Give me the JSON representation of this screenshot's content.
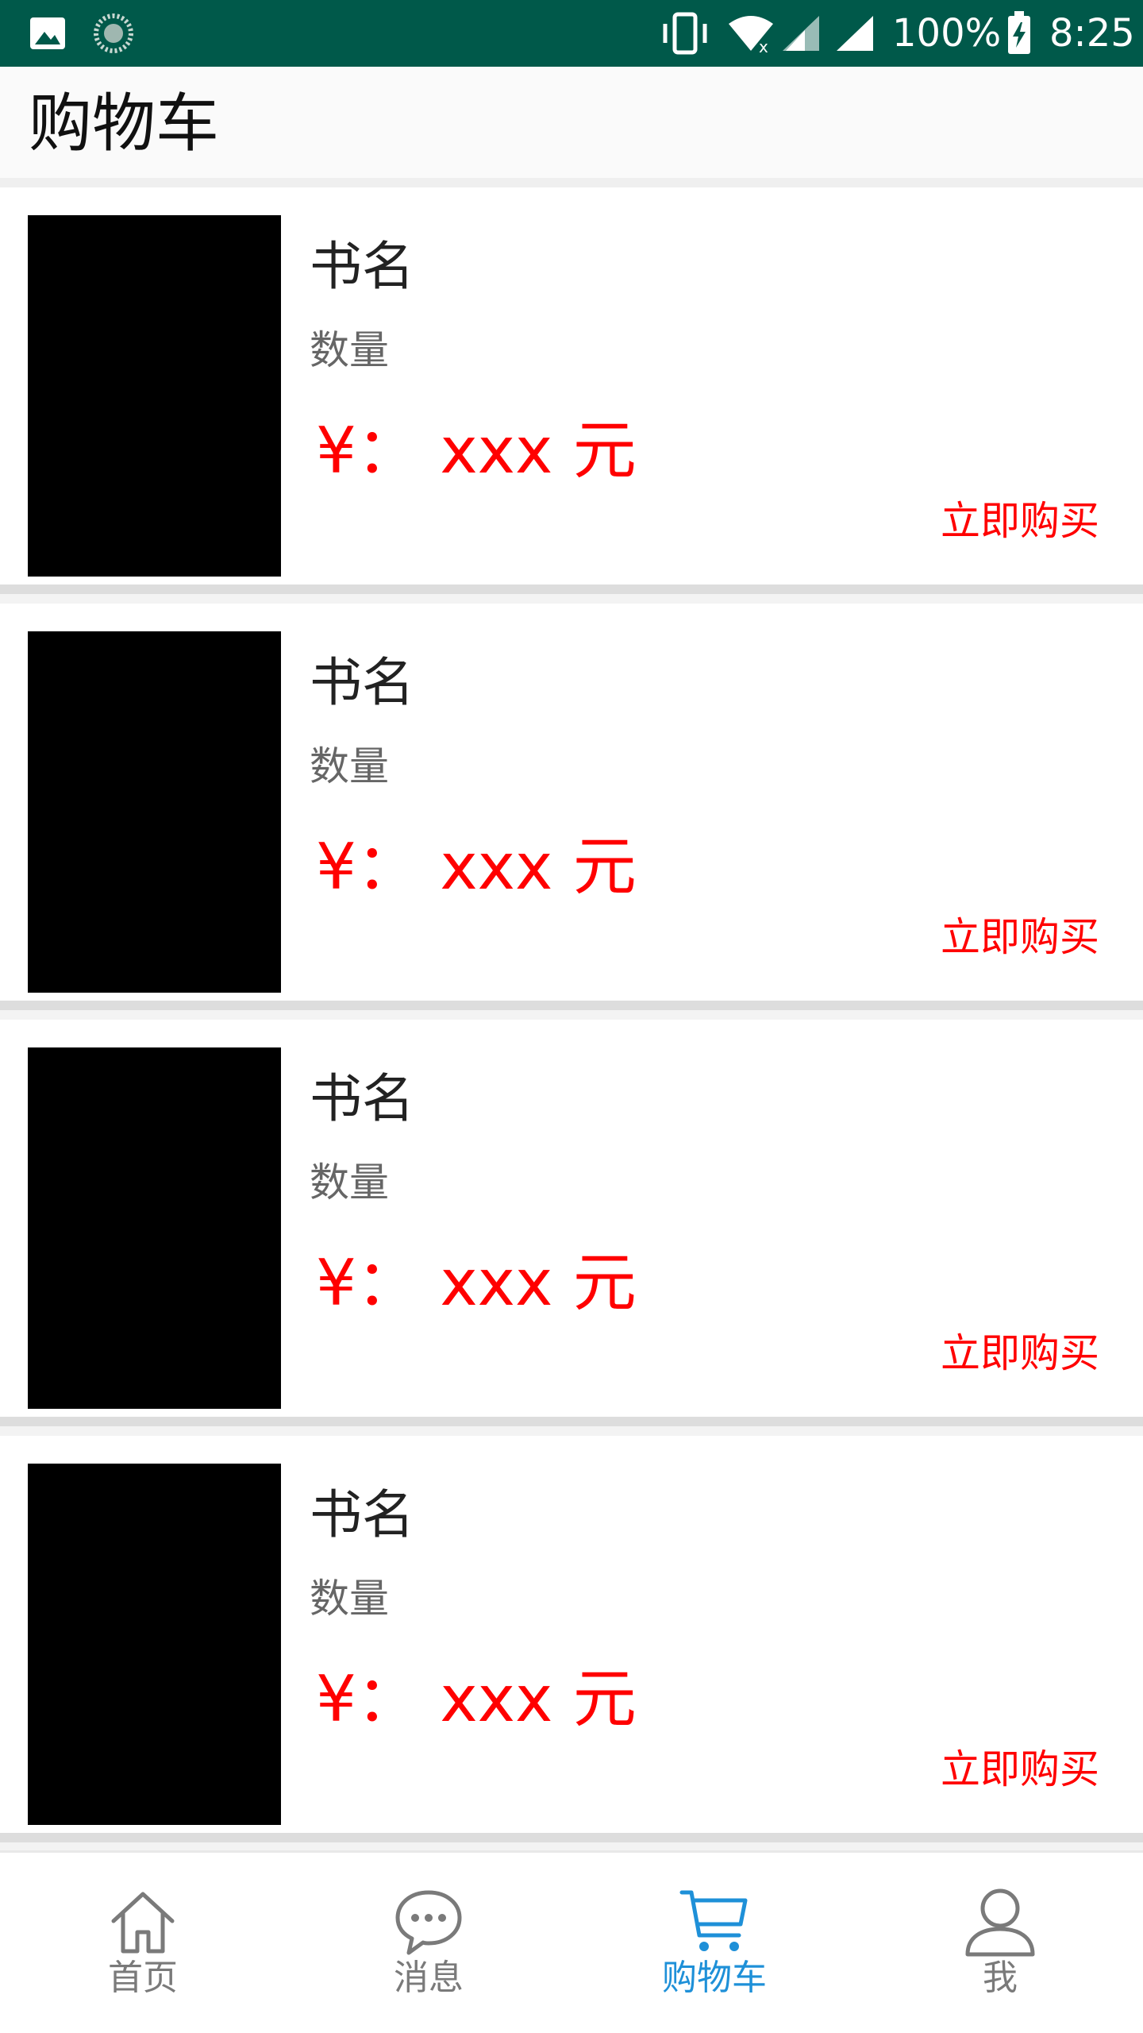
{
  "status_bar": {
    "battery": "100%",
    "time": "8:25",
    "icons": [
      "image-icon",
      "sync-icon",
      "vibrate-icon",
      "wifi-icon",
      "signal-icon",
      "signal-icon",
      "battery-charging-icon"
    ]
  },
  "app_bar": {
    "title": "购物车"
  },
  "cart": {
    "items": [
      {
        "title": "书名",
        "quantity": "数量",
        "price": "¥： xxx 元",
        "buy_label": "立即购买"
      },
      {
        "title": "书名",
        "quantity": "数量",
        "price": "¥： xxx 元",
        "buy_label": "立即购买"
      },
      {
        "title": "书名",
        "quantity": "数量",
        "price": "¥： xxx 元",
        "buy_label": "立即购买"
      },
      {
        "title": "书名",
        "quantity": "数量",
        "price": "¥： xxx 元",
        "buy_label": "立即购买"
      }
    ]
  },
  "bottom_nav": {
    "active_color": "#1e90d8",
    "inactive_color": "#7a7a7a",
    "items": [
      {
        "label": "首页",
        "icon": "home-icon"
      },
      {
        "label": "消息",
        "icon": "message-icon"
      },
      {
        "label": "购物车",
        "icon": "cart-icon",
        "active": true
      },
      {
        "label": "我",
        "icon": "user-icon"
      }
    ]
  }
}
